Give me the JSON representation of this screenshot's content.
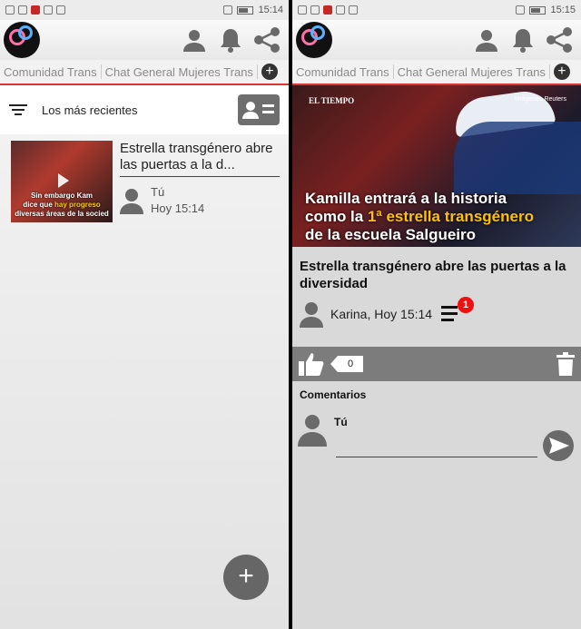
{
  "status_left": {
    "time": "15:14"
  },
  "status_right": {
    "time": "15:15"
  },
  "tabs": [
    "Comunidad Trans",
    "Chat General Mujeres Trans"
  ],
  "left": {
    "filter_label": "Los más recientes",
    "post": {
      "title": "Estrella transgénero abre las puertas a la d...",
      "author": "Tú",
      "time": "Hoy 15:14",
      "thumb_caption_line1": "Sin embargo Kam",
      "thumb_caption_line2_pre": "dice que ",
      "thumb_caption_line2_highlight": "hay progreso",
      "thumb_caption_line3": "diversas áreas de la socied"
    },
    "fab_label": "+"
  },
  "right": {
    "hero": {
      "brand": "EL TIEMPO",
      "source": "Imágenes Reuters",
      "headline_line1": "Kamilla entrará a la historia",
      "headline_line2_pre": "como la ",
      "headline_line2_highlight": "1ª estrella transgénero",
      "headline_line3": "de la escuela Salgueiro"
    },
    "title": "Estrella transgénero abre las puertas a la diversidad",
    "author_time": "Karina, Hoy 15:14",
    "list_badge": "1",
    "like_count": "0",
    "comments_title": "Comentarios",
    "comment_user": "Tú",
    "comment_value": "",
    "comment_placeholder": ""
  },
  "colors": {
    "accent": "#d33333",
    "badge": "#ee1111",
    "highlight": "#ffc107"
  }
}
